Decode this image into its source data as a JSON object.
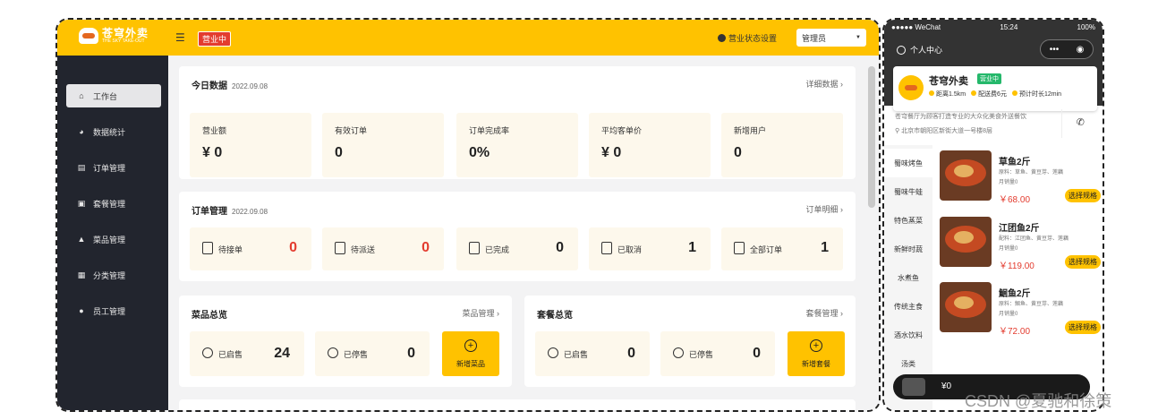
{
  "admin": {
    "logo_main": "苍穹外卖",
    "logo_sub": "THE SKY TAKE-OUT",
    "status_tag": "营业中",
    "business_setting": "营业状态设置",
    "user_dropdown": "管理员",
    "sidebar": [
      {
        "label": "工作台",
        "icon": "home-icon",
        "active": true
      },
      {
        "label": "数据统计",
        "icon": "chart-icon",
        "active": false
      },
      {
        "label": "订单管理",
        "icon": "order-icon",
        "active": false
      },
      {
        "label": "套餐管理",
        "icon": "combo-icon",
        "active": false
      },
      {
        "label": "菜品管理",
        "icon": "dish-icon",
        "active": false
      },
      {
        "label": "分类管理",
        "icon": "category-icon",
        "active": false
      },
      {
        "label": "员工管理",
        "icon": "staff-icon",
        "active": false
      }
    ],
    "today": {
      "title": "今日数据",
      "date": "2022.09.08",
      "link": "详细数据 ›",
      "stats": [
        {
          "label": "营业额",
          "value": "¥ 0"
        },
        {
          "label": "有效订单",
          "value": "0"
        },
        {
          "label": "订单完成率",
          "value": "0%"
        },
        {
          "label": "平均客单价",
          "value": "¥ 0"
        },
        {
          "label": "新增用户",
          "value": "0"
        }
      ]
    },
    "orders": {
      "title": "订单管理",
      "date": "2022.09.08",
      "link": "订单明细 ›",
      "items": [
        {
          "label": "待接单",
          "count": "0",
          "red": true
        },
        {
          "label": "待派送",
          "count": "0",
          "red": true
        },
        {
          "label": "已完成",
          "count": "0",
          "red": false
        },
        {
          "label": "已取消",
          "count": "1",
          "red": false
        },
        {
          "label": "全部订单",
          "count": "1",
          "red": false
        }
      ]
    },
    "dishes": {
      "title": "菜品总览",
      "link": "菜品管理 ›",
      "on_label": "已启售",
      "on_count": "24",
      "off_label": "已停售",
      "off_count": "0",
      "add_label": "新增菜品"
    },
    "combos": {
      "title": "套餐总览",
      "link": "套餐管理 ›",
      "on_label": "已启售",
      "on_count": "0",
      "off_label": "已停售",
      "off_count": "0",
      "add_label": "新增套餐"
    }
  },
  "phone": {
    "status_left": "●●●●● WeChat",
    "status_time": "15:24",
    "status_right": "100%",
    "user_center": "个人中心",
    "capsule_dots": "•••",
    "capsule_circle": "◉",
    "shop_name": "苍穹外卖",
    "shop_badge": "营业中",
    "distance": "距离1.5km",
    "delivery_fee": "配送费6元",
    "delivery_time": "预计时长12min",
    "description": "苍穹餐厅为顾客打造专业的大众化美食外送餐饮",
    "address": "北京市朝阳区新街大道一号楼8层",
    "categories": [
      "蜀味烤鱼",
      "蜀味牛蛙",
      "特色蒸菜",
      "新鲜时蔬",
      "水煮鱼",
      "传统主食",
      "酒水饮料",
      "汤类"
    ],
    "dishes": [
      {
        "name": "草鱼2斤",
        "desc": "原料：草鱼、黄豆芽、莲藕",
        "sales": "月销量0",
        "price": "￥68.00",
        "btn": "选择规格"
      },
      {
        "name": "江团鱼2斤",
        "desc": "配料：江团鱼、黄豆芽、莲藕",
        "sales": "月销量0",
        "price": "￥119.00",
        "btn": "选择规格"
      },
      {
        "name": "鮰鱼2斤",
        "desc": "原料：鮰鱼、黄豆芽、莲藕",
        "sales": "月销量0",
        "price": "￥72.00",
        "btn": "选择规格"
      }
    ],
    "cart_total": "¥0"
  },
  "watermark": "CSDN @夏驰和徐策",
  "colors": {
    "brand": "#ffc200",
    "sidebar": "#22252e",
    "accent_red": "#e33c2f",
    "green": "#25b86b"
  }
}
